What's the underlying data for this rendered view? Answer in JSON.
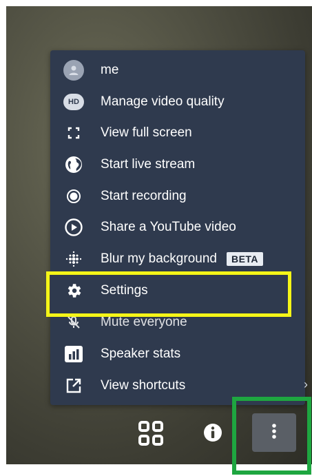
{
  "menu": {
    "items": [
      {
        "label": "me",
        "icon": "avatar-icon"
      },
      {
        "label": "Manage video quality",
        "icon": "hd-icon",
        "icon_text": "HD"
      },
      {
        "label": "View full screen",
        "icon": "fullscreen-icon"
      },
      {
        "label": "Start live stream",
        "icon": "globe-icon"
      },
      {
        "label": "Start recording",
        "icon": "record-icon"
      },
      {
        "label": "Share a YouTube video",
        "icon": "play-circle-icon"
      },
      {
        "label": "Blur my background",
        "icon": "blur-icon",
        "badge": "BETA"
      },
      {
        "label": "Settings",
        "icon": "gear-icon"
      },
      {
        "label": "Mute everyone",
        "icon": "mic-off-icon"
      },
      {
        "label": "Speaker stats",
        "icon": "stats-icon"
      },
      {
        "label": "View shortcuts",
        "icon": "open-external-icon"
      }
    ]
  },
  "toolbar": {
    "tile_view_icon": "tile-view-icon",
    "info_icon": "info-icon",
    "more_icon": "more-vertical-icon"
  },
  "highlight_colors": {
    "settings_box": "#f5f518",
    "more_button_box": "#1ea640"
  }
}
